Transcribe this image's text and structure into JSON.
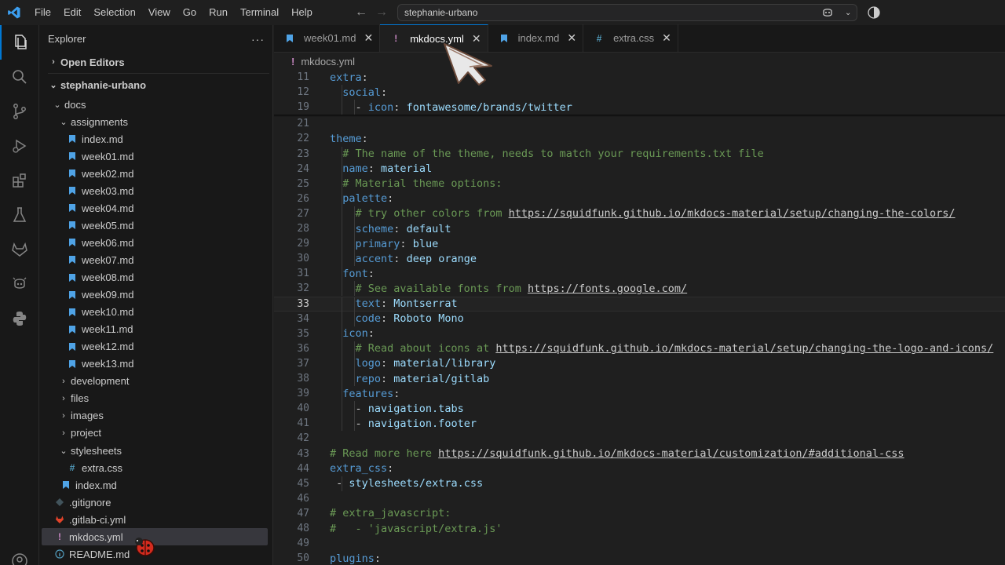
{
  "menu": [
    "File",
    "Edit",
    "Selection",
    "View",
    "Go",
    "Run",
    "Terminal",
    "Help"
  ],
  "command_center": "stephanie-urbano",
  "sidebar": {
    "title": "Explorer",
    "more": "···",
    "open_editors": "Open Editors",
    "workspace": "stephanie-urbano",
    "tree": [
      {
        "label": "docs",
        "depth": 1,
        "chev": "v",
        "icon": ""
      },
      {
        "label": "assignments",
        "depth": 2,
        "chev": "v",
        "icon": ""
      },
      {
        "label": "index.md",
        "depth": 3,
        "chev": "",
        "icon": "md"
      },
      {
        "label": "week01.md",
        "depth": 3,
        "chev": "",
        "icon": "md"
      },
      {
        "label": "week02.md",
        "depth": 3,
        "chev": "",
        "icon": "md"
      },
      {
        "label": "week03.md",
        "depth": 3,
        "chev": "",
        "icon": "md"
      },
      {
        "label": "week04.md",
        "depth": 3,
        "chev": "",
        "icon": "md"
      },
      {
        "label": "week05.md",
        "depth": 3,
        "chev": "",
        "icon": "md"
      },
      {
        "label": "week06.md",
        "depth": 3,
        "chev": "",
        "icon": "md"
      },
      {
        "label": "week07.md",
        "depth": 3,
        "chev": "",
        "icon": "md"
      },
      {
        "label": "week08.md",
        "depth": 3,
        "chev": "",
        "icon": "md"
      },
      {
        "label": "week09.md",
        "depth": 3,
        "chev": "",
        "icon": "md"
      },
      {
        "label": "week10.md",
        "depth": 3,
        "chev": "",
        "icon": "md"
      },
      {
        "label": "week11.md",
        "depth": 3,
        "chev": "",
        "icon": "md"
      },
      {
        "label": "week12.md",
        "depth": 3,
        "chev": "",
        "icon": "md"
      },
      {
        "label": "week13.md",
        "depth": 3,
        "chev": "",
        "icon": "md"
      },
      {
        "label": "development",
        "depth": 2,
        "chev": ">",
        "icon": ""
      },
      {
        "label": "files",
        "depth": 2,
        "chev": ">",
        "icon": ""
      },
      {
        "label": "images",
        "depth": 2,
        "chev": ">",
        "icon": ""
      },
      {
        "label": "project",
        "depth": 2,
        "chev": ">",
        "icon": ""
      },
      {
        "label": "stylesheets",
        "depth": 2,
        "chev": "v",
        "icon": ""
      },
      {
        "label": "extra.css",
        "depth": 3,
        "chev": "",
        "icon": "css"
      },
      {
        "label": "index.md",
        "depth": 2,
        "chev": "",
        "icon": "md"
      },
      {
        "label": ".gitignore",
        "depth": 1,
        "chev": "",
        "icon": "git"
      },
      {
        "label": ".gitlab-ci.yml",
        "depth": 1,
        "chev": "",
        "icon": "gitlab"
      },
      {
        "label": "mkdocs.yml",
        "depth": 1,
        "chev": "",
        "icon": "yml",
        "selected": true
      },
      {
        "label": "README.md",
        "depth": 1,
        "chev": "",
        "icon": "info"
      }
    ]
  },
  "tabs": [
    {
      "label": "week01.md",
      "icon": "md",
      "active": false
    },
    {
      "label": "mkdocs.yml",
      "icon": "yml",
      "active": true
    },
    {
      "label": "index.md",
      "icon": "md",
      "active": false
    },
    {
      "label": "extra.css",
      "icon": "css",
      "active": false
    }
  ],
  "breadcrumb": "mkdocs.yml",
  "code_lines": [
    {
      "n": "11",
      "html": "<span class='k'>extra</span><span class='p'>:</span>",
      "guides": 0
    },
    {
      "n": "12",
      "html": "  <span class='k'>social</span><span class='p'>:</span>",
      "guides": 1
    },
    {
      "n": "19",
      "html": "    <span class='p'>- </span><span class='k'>icon</span><span class='p'>: </span><span class='v'>fontawesome/brands/twitter</span>",
      "guides": 2
    },
    {
      "n": "21",
      "html": "",
      "guides": 0
    },
    {
      "n": "22",
      "html": "<span class='k'>theme</span><span class='p'>:</span>",
      "guides": 0
    },
    {
      "n": "23",
      "html": "  <span class='c'># The name of the theme, needs to match your requirements.txt file</span>",
      "guides": 1
    },
    {
      "n": "24",
      "html": "  <span class='k'>name</span><span class='p'>: </span><span class='v'>material</span>",
      "guides": 1
    },
    {
      "n": "25",
      "html": "  <span class='c'># Material theme options:</span>",
      "guides": 1
    },
    {
      "n": "26",
      "html": "  <span class='k'>palette</span><span class='p'>:</span>",
      "guides": 1
    },
    {
      "n": "27",
      "html": "    <span class='c'># try other colors from </span><span class='u'>https://squidfunk.github.io/mkdocs-material/setup/changing-the-colors/</span>",
      "guides": 2
    },
    {
      "n": "28",
      "html": "    <span class='k'>scheme</span><span class='p'>: </span><span class='v'>default</span>",
      "guides": 2
    },
    {
      "n": "29",
      "html": "    <span class='k'>primary</span><span class='p'>: </span><span class='v'>blue</span>",
      "guides": 2
    },
    {
      "n": "30",
      "html": "    <span class='k'>accent</span><span class='p'>: </span><span class='v'>deep orange</span>",
      "guides": 2
    },
    {
      "n": "31",
      "html": "  <span class='k'>font</span><span class='p'>:</span>",
      "guides": 1
    },
    {
      "n": "32",
      "html": "    <span class='c'># See available fonts from </span><span class='u'>https://fonts.google.com/</span>",
      "guides": 2
    },
    {
      "n": "33",
      "html": "    <span class='k'>text</span><span class='p'>: </span><span class='v'>Montserrat</span>",
      "guides": 2,
      "current": true
    },
    {
      "n": "34",
      "html": "    <span class='k'>code</span><span class='p'>: </span><span class='v'>Roboto Mono</span>",
      "guides": 2
    },
    {
      "n": "35",
      "html": "  <span class='k'>icon</span><span class='p'>:</span>",
      "guides": 1
    },
    {
      "n": "36",
      "html": "    <span class='c'># Read about icons at </span><span class='u'>https://squidfunk.github.io/mkdocs-material/setup/changing-the-logo-and-icons/</span>",
      "guides": 2
    },
    {
      "n": "37",
      "html": "    <span class='k'>logo</span><span class='p'>: </span><span class='v'>material/library</span>",
      "guides": 2
    },
    {
      "n": "38",
      "html": "    <span class='k'>repo</span><span class='p'>: </span><span class='v'>material/gitlab</span>",
      "guides": 2
    },
    {
      "n": "39",
      "html": "  <span class='k'>features</span><span class='p'>:</span>",
      "guides": 1
    },
    {
      "n": "40",
      "html": "    <span class='p'>- </span><span class='v'>navigation.tabs</span>",
      "guides": 2
    },
    {
      "n": "41",
      "html": "    <span class='p'>- </span><span class='v'>navigation.footer</span>",
      "guides": 2
    },
    {
      "n": "42",
      "html": "",
      "guides": 0
    },
    {
      "n": "43",
      "html": "<span class='c'># Read more here </span><span class='u'>https://squidfunk.github.io/mkdocs-material/customization/#additional-css</span>",
      "guides": 0
    },
    {
      "n": "44",
      "html": "<span class='k'>extra_css</span><span class='p'>:</span>",
      "guides": 0
    },
    {
      "n": "45",
      "html": " <span class='p'>- </span><span class='v'>stylesheets/extra.css</span>",
      "guides": 1
    },
    {
      "n": "46",
      "html": "",
      "guides": 0
    },
    {
      "n": "47",
      "html": "<span class='c'># extra_javascript:</span>",
      "guides": 0
    },
    {
      "n": "48",
      "html": "<span class='c'>#   - 'javascript/extra.js'</span>",
      "guides": 0
    },
    {
      "n": "49",
      "html": "",
      "guides": 0
    },
    {
      "n": "50",
      "html": "<span class='k'>plugins</span><span class='p'>:</span>",
      "guides": 0
    }
  ]
}
